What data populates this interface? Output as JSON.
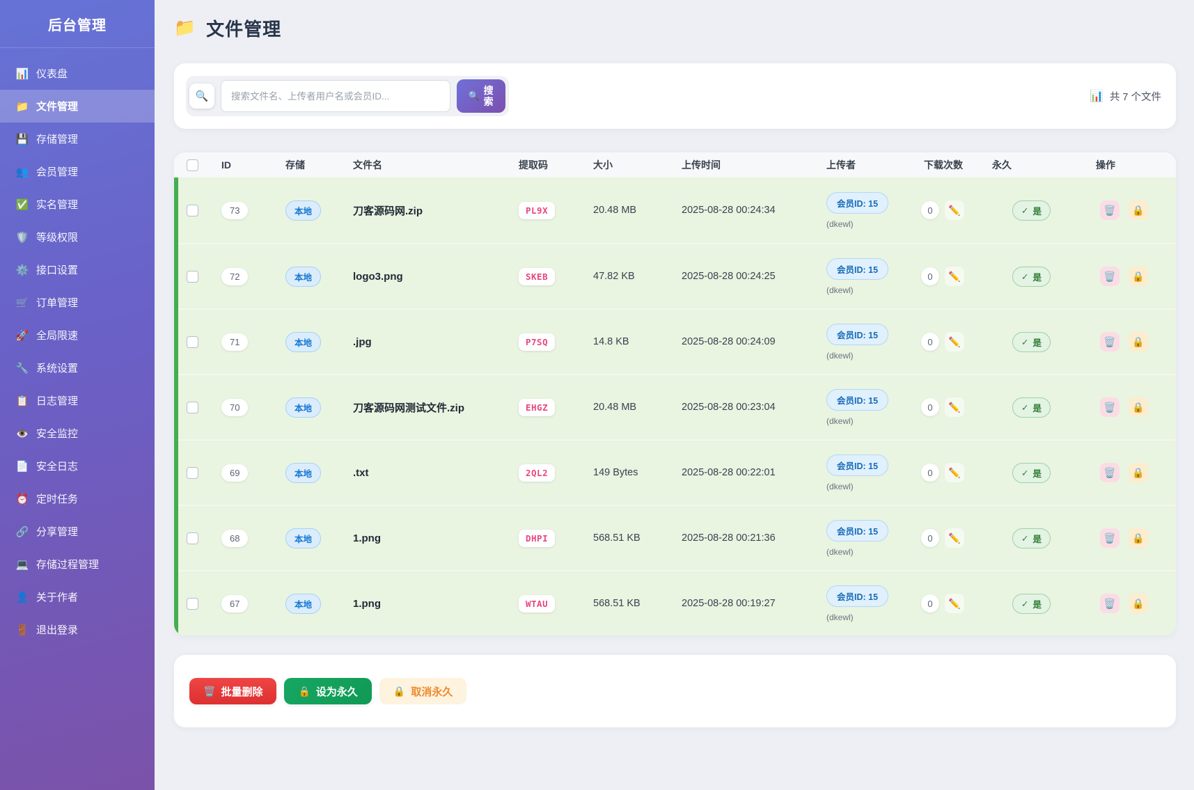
{
  "sidebar": {
    "title": "后台管理",
    "items": [
      {
        "icon": "📊",
        "label": "仪表盘",
        "active": false
      },
      {
        "icon": "📁",
        "label": "文件管理",
        "active": true
      },
      {
        "icon": "💾",
        "label": "存储管理",
        "active": false
      },
      {
        "icon": "👥",
        "label": "会员管理",
        "active": false
      },
      {
        "icon": "✅",
        "label": "实名管理",
        "active": false
      },
      {
        "icon": "🛡️",
        "label": "等级权限",
        "active": false
      },
      {
        "icon": "⚙️",
        "label": "接口设置",
        "active": false
      },
      {
        "icon": "🛒",
        "label": "订单管理",
        "active": false
      },
      {
        "icon": "🚀",
        "label": "全局限速",
        "active": false
      },
      {
        "icon": "🔧",
        "label": "系统设置",
        "active": false
      },
      {
        "icon": "📋",
        "label": "日志管理",
        "active": false
      },
      {
        "icon": "👁️",
        "label": "安全监控",
        "active": false
      },
      {
        "icon": "📄",
        "label": "安全日志",
        "active": false
      },
      {
        "icon": "⏰",
        "label": "定时任务",
        "active": false
      },
      {
        "icon": "🔗",
        "label": "分享管理",
        "active": false
      },
      {
        "icon": "💻",
        "label": "存储过程管理",
        "active": false
      },
      {
        "icon": "👤",
        "label": "关于作者",
        "active": false
      },
      {
        "icon": "🚪",
        "label": "退出登录",
        "active": false
      }
    ]
  },
  "header": {
    "icon": "📁",
    "title": "文件管理"
  },
  "search": {
    "icon": "🔍",
    "placeholder": "搜索文件名、上传者用户名或会员ID...",
    "button_icon": "🔍",
    "button_label": "搜索",
    "count_icon": "📊",
    "count_text": "共 7 个文件"
  },
  "table": {
    "columns": [
      "ID",
      "存储",
      "文件名",
      "提取码",
      "大小",
      "上传时间",
      "上传者",
      "下载次数",
      "永久",
      "操作"
    ],
    "row_icons": {
      "edit": "✏️",
      "delete": "🗑️",
      "lock": "🔒",
      "check": "✓"
    },
    "rows": [
      {
        "id": "73",
        "storage": "本地",
        "filename": "刀客源码网.zip",
        "code": "PL9X",
        "size": "20.48 MB",
        "uploaded": "2025-08-28 00:24:34",
        "uploader_id": "会员ID: 15",
        "uploader_name": "(dkewl)",
        "downloads": "0",
        "permanent": "是"
      },
      {
        "id": "72",
        "storage": "本地",
        "filename": "logo3.png",
        "code": "SKEB",
        "size": "47.82 KB",
        "uploaded": "2025-08-28 00:24:25",
        "uploader_id": "会员ID: 15",
        "uploader_name": "(dkewl)",
        "downloads": "0",
        "permanent": "是"
      },
      {
        "id": "71",
        "storage": "本地",
        "filename": ".jpg",
        "code": "P7SQ",
        "size": "14.8 KB",
        "uploaded": "2025-08-28 00:24:09",
        "uploader_id": "会员ID: 15",
        "uploader_name": "(dkewl)",
        "downloads": "0",
        "permanent": "是"
      },
      {
        "id": "70",
        "storage": "本地",
        "filename": "刀客源码网测试文件.zip",
        "code": "EHGZ",
        "size": "20.48 MB",
        "uploaded": "2025-08-28 00:23:04",
        "uploader_id": "会员ID: 15",
        "uploader_name": "(dkewl)",
        "downloads": "0",
        "permanent": "是"
      },
      {
        "id": "69",
        "storage": "本地",
        "filename": ".txt",
        "code": "2QL2",
        "size": "149 Bytes",
        "uploaded": "2025-08-28 00:22:01",
        "uploader_id": "会员ID: 15",
        "uploader_name": "(dkewl)",
        "downloads": "0",
        "permanent": "是"
      },
      {
        "id": "68",
        "storage": "本地",
        "filename": "1.png",
        "code": "DHPI",
        "size": "568.51 KB",
        "uploaded": "2025-08-28 00:21:36",
        "uploader_id": "会员ID: 15",
        "uploader_name": "(dkewl)",
        "downloads": "0",
        "permanent": "是"
      },
      {
        "id": "67",
        "storage": "本地",
        "filename": "1.png",
        "code": "WTAU",
        "size": "568.51 KB",
        "uploaded": "2025-08-28 00:19:27",
        "uploader_id": "会员ID: 15",
        "uploader_name": "(dkewl)",
        "downloads": "0",
        "permanent": "是"
      }
    ]
  },
  "actions": [
    {
      "icon": "🗑️",
      "label": "批量删除"
    },
    {
      "icon": "🔒",
      "label": "设为永久"
    },
    {
      "icon": "🔒",
      "label": "取消永久"
    }
  ],
  "colors": {
    "sidebar_gradient_top": "#6673d6",
    "sidebar_gradient_bottom": "#7b52a9",
    "row_background": "#e9f4e1",
    "row_accent_bar": "#45ad4e",
    "storage_badge_text": "#1878d2",
    "code_text": "#e8467c",
    "permanent_text": "#2e7d32",
    "delete_button": "#dd3030",
    "permanent_button": "#0f9a55",
    "cancel_button_text": "#ed8a2f"
  }
}
